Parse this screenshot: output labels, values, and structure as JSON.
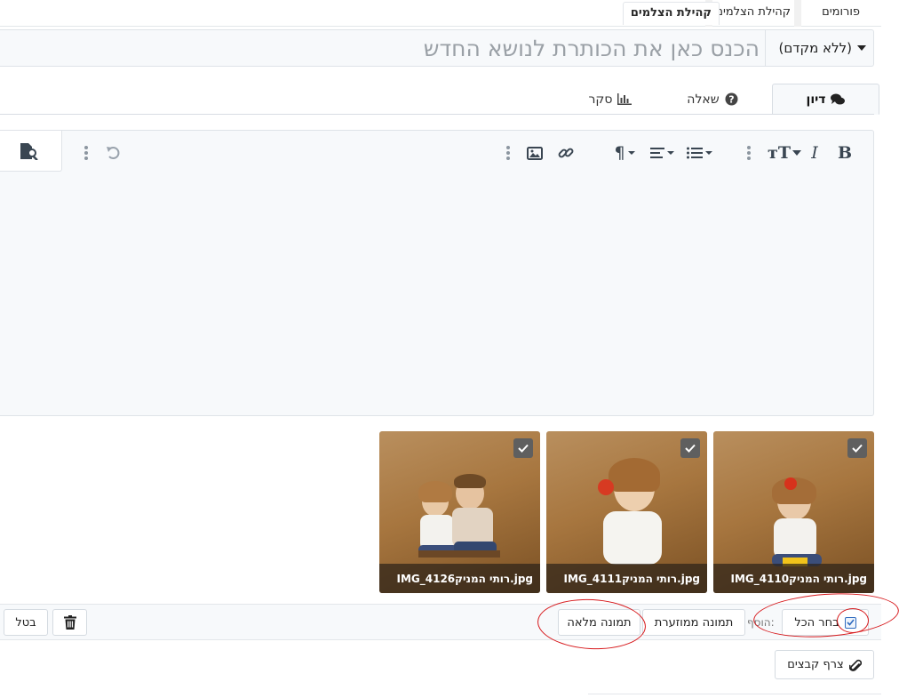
{
  "breadcrumbs": [
    {
      "label": "פורומים"
    },
    {
      "label": "קהילת הצלמים"
    },
    {
      "label": "קהילת הצלמים",
      "active": true
    }
  ],
  "title_row": {
    "prefix_value": "(ללא מקדם)",
    "title_placeholder": "הכנס כאן את הכותרת לנושא החדש"
  },
  "tabs": [
    {
      "label": "דיון",
      "icon": "comments-icon",
      "active": true
    },
    {
      "label": "שאלה",
      "icon": "question-circle-icon"
    },
    {
      "label": "סקר",
      "icon": "bar-chart-icon"
    }
  ],
  "toolbar": {
    "bold": "B",
    "italic": "I",
    "text_size": "тT",
    "paragraph": "¶",
    "icons": [
      "bold-icon",
      "italic-icon",
      "text-size-icon",
      "list-icon",
      "align-icon",
      "paragraph-icon",
      "link-icon",
      "image-icon",
      "undo-icon",
      "preview-icon"
    ]
  },
  "attachments": [
    {
      "filename": "IMG_4110רותי המניק.jpg",
      "checked": true
    },
    {
      "filename": "IMG_4111רותי המניק.jpg",
      "checked": true
    },
    {
      "filename": "IMG_4126רותי המניק.jpg",
      "checked": true
    }
  ],
  "action_bar": {
    "select_all_label": "בחר הכל",
    "add_label": "הוסף:",
    "thumbnail_button": "תמונה ממוזערת",
    "full_image_button": "תמונה מלאה",
    "cancel_button": "בטל"
  },
  "attach_files_button": "צרף קבצים",
  "colors": {
    "annotation": "#d7191c",
    "checkbox_accent": "#2f6bbf",
    "editor_bg": "#f7f9fb"
  }
}
